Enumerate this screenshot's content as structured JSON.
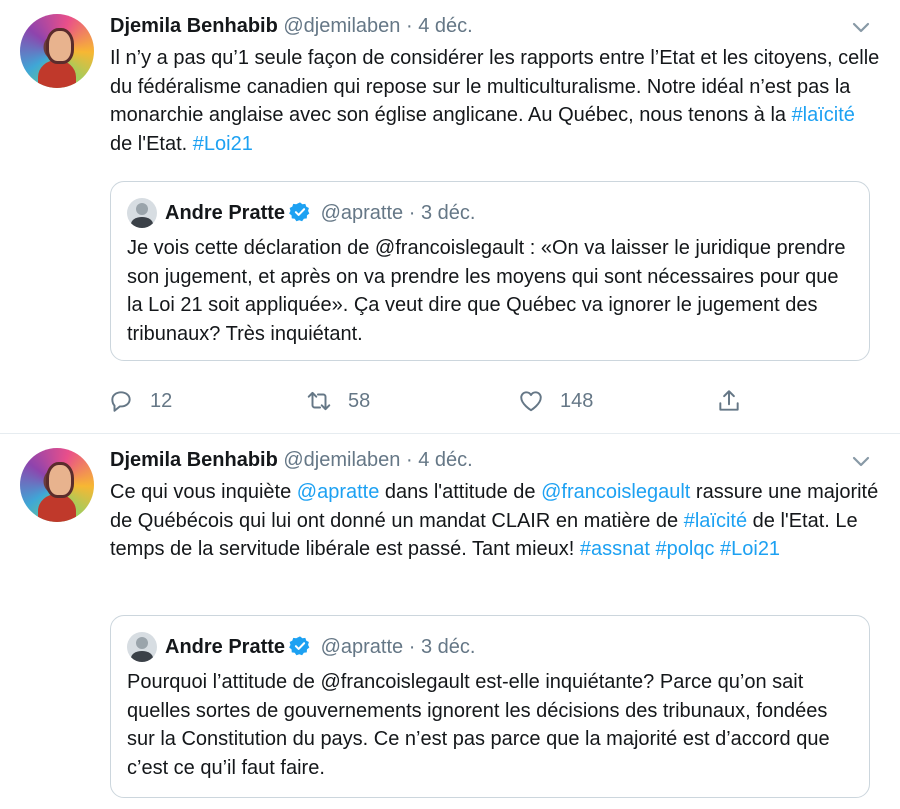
{
  "tweets": [
    {
      "author_name": "Djemila Benhabib",
      "handle": "@djemilaben",
      "separator": "·",
      "date": "4 déc.",
      "text_parts": [
        "Il n’y a pas qu’1 seule façon de considérer les rapports entre l’Etat et les citoyens, celle du fédéralisme canadien qui repose sur le multiculturalisme.  Notre idéal n’est pas la monarchie anglaise avec son église anglicane. Au Québec, nous tenons à la ",
        "#laïcité",
        " de l'Etat. ",
        "#Loi21"
      ],
      "quote": {
        "author_name": "Andre Pratte",
        "handle": "@apratte",
        "separator": "·",
        "date": "3 déc.",
        "text": "Je vois cette déclaration de @francoislegault : «On va laisser le juridique prendre son jugement, et après on va prendre les moyens qui sont nécessaires pour que la Loi 21 soit appliquée». Ça veut dire que Québec va ignorer le jugement des tribunaux? Très inquiétant."
      },
      "actions": {
        "replies": "12",
        "retweets": "58",
        "likes": "148"
      }
    },
    {
      "author_name": "Djemila Benhabib",
      "handle": "@djemilaben",
      "separator": "·",
      "date": "4 déc.",
      "text_parts": [
        "Ce qui vous inquiète ",
        "@apratte",
        " dans l'attitude de ",
        "@francoislegault",
        " rassure une majorité de Québécois qui lui ont donné un mandat CLAIR en matière de ",
        "#laïcité",
        " de l'Etat. Le temps de la servitude libérale est passé. Tant mieux! ",
        "#assnat",
        " ",
        "#polqc",
        " ",
        "#Loi21"
      ],
      "quote": {
        "author_name": "Andre Pratte",
        "handle": "@apratte",
        "separator": "·",
        "date": "3 déc.",
        "text": "Pourquoi l’attitude de @francoislegault est-elle inquiétante? Parce qu’on sait quelles sortes de gouvernements ignorent les décisions des tribunaux, fondées sur la Constitution du pays. Ce n’est pas parce que la majorité est d’accord que c’est ce qu’il faut faire."
      }
    }
  ],
  "icons": {
    "caret": "chevron-down-icon",
    "reply": "reply-icon",
    "retweet": "retweet-icon",
    "like": "heart-icon",
    "share": "share-icon",
    "verified": "verified-badge-icon"
  },
  "colors": {
    "link": "#1da1f2",
    "muted": "#657786",
    "border": "#ccd6dd",
    "divider": "#e6ecf0"
  }
}
